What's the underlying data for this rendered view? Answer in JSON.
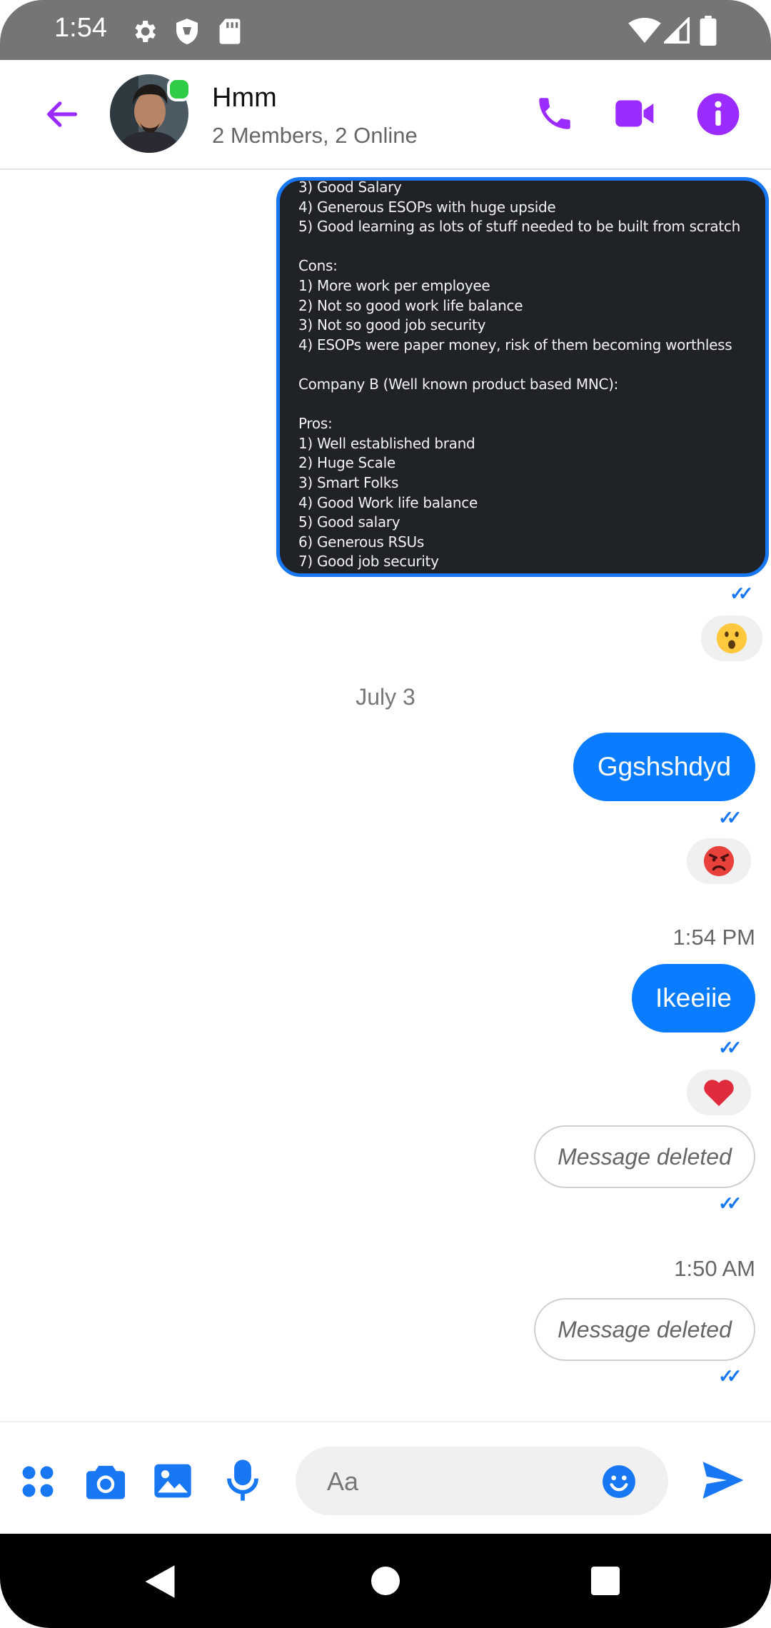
{
  "status_bar": {
    "time": "1:54",
    "left_icons": [
      "gear-icon",
      "shield-icon",
      "sd-card-icon"
    ],
    "right_icons": [
      "wifi-icon",
      "cell-signal-icon",
      "battery-icon"
    ]
  },
  "header": {
    "title": "Hmm",
    "subtitle": "2 Members, 2 Online",
    "online_status_color": "#31cc46",
    "accent_color": "#9b2bff",
    "actions": [
      "back-arrow-icon",
      "phone-icon",
      "video-camera-icon",
      "info-icon"
    ]
  },
  "messages": {
    "image_text": "3) Good Salary\n4) Generous ESOPs with huge upside\n5) Good learning as lots of stuff needed to be built from scratch\n\nCons:\n1) More work per employee\n2) Not so good work life balance\n3) Not so good job security\n4) ESOPs were paper money, risk of them becoming worthless\n\nCompany B (Well known product based MNC):\n\nPros:\n1) Well established brand\n2) Huge Scale\n3) Smart Folks\n4) Good Work life balance\n5) Good salary\n6) Generous RSUs\n7) Good job security",
    "date_separator": "July 3",
    "msg1_text": "Ggshshdyd",
    "time_1": "1:54 PM",
    "msg2_text": "Ikeeiie",
    "deleted_1": "Message deleted",
    "time_2": "1:50 AM",
    "deleted_2": "Message deleted",
    "reactions": [
      "surprised-face",
      "angry-face",
      "red-heart"
    ],
    "bubble_color": "#0a7cff"
  },
  "composer": {
    "placeholder": "Aa",
    "icons": [
      "apps-icon",
      "camera-icon",
      "gallery-icon",
      "microphone-icon",
      "emoji-icon",
      "send-icon"
    ],
    "icon_color": "#1877f2"
  },
  "nav_bar": {
    "buttons": [
      "back-triangle-icon",
      "home-circle-icon",
      "recents-square-icon"
    ]
  }
}
